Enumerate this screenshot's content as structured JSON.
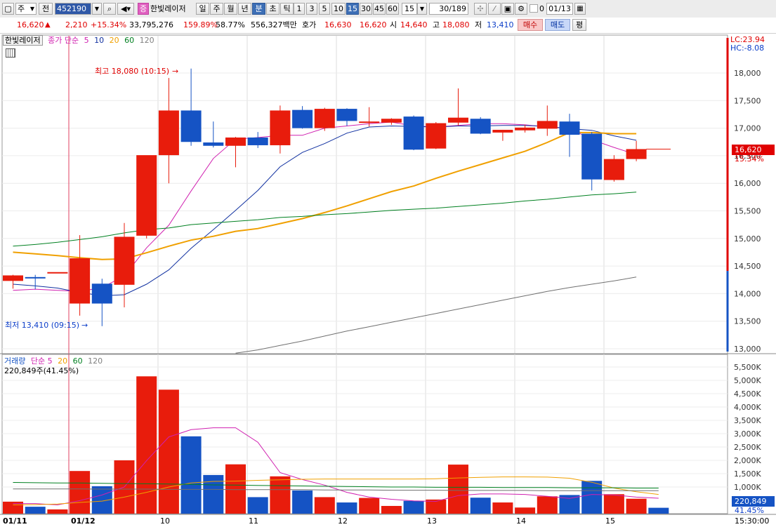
{
  "toolbar": {
    "market": "주",
    "prev_label": "전",
    "stock_code": "452190",
    "badge": "증",
    "stock_name": "한빛레이저",
    "period_tabs": [
      "일",
      "주",
      "월",
      "년",
      "분",
      "초",
      "틱"
    ],
    "active_period": "분",
    "interval_buttons": [
      "1",
      "3",
      "5",
      "10",
      "15",
      "30",
      "45",
      "60"
    ],
    "active_interval": "15",
    "interval_value": "15",
    "count_value": "30/189",
    "checkbox_label": "0",
    "date_value": "01/13"
  },
  "quote": {
    "price": "16,620",
    "direction": "▲",
    "change": "2,210",
    "change_pct": "+15.34%",
    "volume": "33,795,276",
    "ratio1": "159.89%",
    "ratio2": "58.77%",
    "amount": "556,327백만",
    "ask_label": "호가",
    "ask": "16,630",
    "bid": "16,620",
    "open_label": "시",
    "open": "14,640",
    "high_label": "고",
    "high": "18,080",
    "low_label": "저",
    "low": "13,410",
    "buy_label": "매수",
    "sell_label": "매도",
    "avg_label": "평"
  },
  "price_panel": {
    "tab_label": "한빛레이저",
    "legend_title": "종가 단순",
    "ma_periods": [
      "5",
      "10",
      "20",
      "60",
      "120"
    ],
    "ma_colors": [
      "#d020b0",
      "#1030a0",
      "#f0a000",
      "#008020",
      "#808080"
    ],
    "lc_label": "LC:23.94",
    "hc_label": "HC:-8.08",
    "current_price_tag": "16,620",
    "current_pct_tag": "15.34%",
    "high_annotation": "최고 18,080 (10:15)",
    "low_annotation": "최저 13,410 (09:15)"
  },
  "volume_panel": {
    "legend_title": "거래량",
    "legend_sub": "단순",
    "ma_periods": [
      "5",
      "20",
      "60",
      "120"
    ],
    "current_volume_label": "220,849주(41.45%)",
    "volume_tag": "220,849",
    "pct_tag": "41.45%"
  },
  "x_axis": {
    "labels": [
      "01/11",
      "01/12",
      "10",
      "11",
      "12",
      "13",
      "14",
      "15"
    ],
    "right_label": "15:30:00"
  },
  "chart_data": [
    {
      "type": "candlestick",
      "title": "한빛레이저",
      "unit": "원",
      "ylim": [
        13000,
        18400
      ],
      "yticks": [
        13000,
        13500,
        14000,
        14500,
        15000,
        15500,
        16000,
        16500,
        17000,
        17500,
        18000
      ],
      "candles": [
        {
          "o": 14230,
          "h": 14340,
          "l": 14090,
          "c": 14330
        },
        {
          "o": 14300,
          "h": 14340,
          "l": 14080,
          "c": 14280
        },
        {
          "o": 14390,
          "h": 14390,
          "l": 14390,
          "c": 14390
        },
        {
          "o": 13820,
          "h": 15060,
          "l": 13600,
          "c": 14640
        },
        {
          "o": 14180,
          "h": 14270,
          "l": 13410,
          "c": 13820
        },
        {
          "o": 14160,
          "h": 15280,
          "l": 13750,
          "c": 15030
        },
        {
          "o": 15050,
          "h": 16050,
          "l": 15000,
          "c": 16510
        },
        {
          "o": 16510,
          "h": 17910,
          "l": 16000,
          "c": 17320
        },
        {
          "o": 17320,
          "h": 18080,
          "l": 16680,
          "c": 16750
        },
        {
          "o": 16740,
          "h": 17120,
          "l": 16650,
          "c": 16680
        },
        {
          "o": 16680,
          "h": 16840,
          "l": 16290,
          "c": 16830
        },
        {
          "o": 16830,
          "h": 16930,
          "l": 16640,
          "c": 16690
        },
        {
          "o": 16690,
          "h": 17410,
          "l": 16540,
          "c": 17320
        },
        {
          "o": 17330,
          "h": 17400,
          "l": 16990,
          "c": 17000
        },
        {
          "o": 17000,
          "h": 17370,
          "l": 16950,
          "c": 17350
        },
        {
          "o": 17350,
          "h": 17360,
          "l": 17040,
          "c": 17130
        },
        {
          "o": 17100,
          "h": 17380,
          "l": 17030,
          "c": 17120
        },
        {
          "o": 17100,
          "h": 17180,
          "l": 17060,
          "c": 17170
        },
        {
          "o": 17210,
          "h": 17230,
          "l": 16600,
          "c": 16610
        },
        {
          "o": 16630,
          "h": 17110,
          "l": 16620,
          "c": 17090
        },
        {
          "o": 17100,
          "h": 17720,
          "l": 17050,
          "c": 17190
        },
        {
          "o": 17170,
          "h": 17200,
          "l": 16890,
          "c": 16900
        },
        {
          "o": 16920,
          "h": 16970,
          "l": 16770,
          "c": 16970
        },
        {
          "o": 16960,
          "h": 17060,
          "l": 16920,
          "c": 17010
        },
        {
          "o": 16990,
          "h": 17410,
          "l": 16860,
          "c": 17130
        },
        {
          "o": 17120,
          "h": 17260,
          "l": 16480,
          "c": 16880
        },
        {
          "o": 16900,
          "h": 16930,
          "l": 15870,
          "c": 16070
        },
        {
          "o": 16060,
          "h": 16510,
          "l": 16030,
          "c": 16440
        },
        {
          "o": 16440,
          "h": 16770,
          "l": 16400,
          "c": 16620
        }
      ],
      "ma": {
        "5": [
          14060,
          14080,
          14060,
          14040,
          14110,
          14320,
          14830,
          15240,
          15860,
          16450,
          16800,
          16830,
          16870,
          16870,
          17000,
          17040,
          17080,
          17110,
          17040,
          17020,
          17050,
          17080,
          17080,
          17060,
          17020,
          17000,
          16790,
          16650,
          16520
        ],
        "10": [
          14170,
          14140,
          14100,
          14020,
          13960,
          13980,
          14170,
          14430,
          14820,
          15160,
          15510,
          15870,
          16300,
          16560,
          16720,
          16910,
          17020,
          17040,
          17030,
          17020,
          17040,
          17040,
          17050,
          17050,
          17030,
          16990,
          16960,
          16860,
          16780
        ],
        "20": [
          14750,
          14720,
          14690,
          14650,
          14620,
          14630,
          14740,
          14860,
          14970,
          15040,
          15130,
          15180,
          15270,
          15360,
          15470,
          15590,
          15720,
          15850,
          15950,
          16090,
          16220,
          16340,
          16460,
          16580,
          16740,
          16920,
          16920,
          16900,
          16900
        ],
        "60": [
          14860,
          14890,
          14930,
          14980,
          15030,
          15100,
          15160,
          15190,
          15250,
          15280,
          15310,
          15340,
          15380,
          15400,
          15430,
          15450,
          15480,
          15510,
          15530,
          15550,
          15580,
          15610,
          15640,
          15680,
          15710,
          15750,
          15790,
          15810,
          15840
        ],
        "120": [
          null,
          null,
          null,
          null,
          null,
          null,
          null,
          null,
          null,
          null,
          12920,
          12980,
          13060,
          13140,
          13230,
          13320,
          13400,
          13480,
          13560,
          13640,
          13720,
          13800,
          13880,
          13960,
          14040,
          14110,
          14170,
          14230,
          14300
        ]
      }
    },
    {
      "type": "bar",
      "title": "거래량",
      "ylim": [
        0,
        5700000
      ],
      "yticks_labels": [
        "1,000K",
        "1,500K",
        "2,000K",
        "2,500K",
        "3,000K",
        "3,500K",
        "4,000K",
        "4,500K",
        "5,000K",
        "5,500K"
      ],
      "values": [
        450000,
        260000,
        160000,
        1600000,
        1030000,
        2000000,
        5150000,
        4650000,
        2900000,
        1450000,
        1850000,
        620000,
        1400000,
        870000,
        620000,
        420000,
        590000,
        290000,
        480000,
        530000,
        1840000,
        600000,
        420000,
        230000,
        650000,
        700000,
        1230000,
        730000,
        560000,
        220849
      ],
      "ma": {
        "5": [
          380000,
          380000,
          330000,
          490000,
          700000,
          1000000,
          1990000,
          2880000,
          3150000,
          3220000,
          3220000,
          2680000,
          1540000,
          1280000,
          1070000,
          800000,
          620000,
          540000,
          480000,
          460000,
          680000,
          740000,
          740000,
          720000,
          650000,
          570000,
          720000,
          700000,
          620000,
          580000
        ],
        "20": [
          330000,
          340000,
          360000,
          420000,
          470000,
          620000,
          800000,
          1000000,
          1150000,
          1210000,
          1220000,
          1250000,
          1270000,
          1290000,
          1300000,
          1300000,
          1300000,
          1300000,
          1300000,
          1310000,
          1340000,
          1360000,
          1380000,
          1380000,
          1370000,
          1330000,
          1180000,
          960000,
          820000,
          720000
        ],
        "60": [
          1170000,
          1160000,
          1150000,
          1150000,
          1140000,
          1130000,
          1120000,
          1110000,
          1100000,
          1080000,
          1070000,
          1060000,
          1050000,
          1040000,
          1030000,
          1020000,
          1010000,
          1000000,
          1000000,
          990000,
          990000,
          990000,
          980000,
          980000,
          980000,
          970000,
          970000,
          970000,
          960000,
          960000
        ],
        "120": [
          930000,
          930000,
          930000,
          930000,
          920000,
          920000,
          920000,
          910000,
          910000,
          910000,
          900000,
          900000,
          900000,
          900000,
          890000,
          890000,
          890000,
          880000,
          880000,
          880000,
          870000,
          870000,
          870000,
          870000,
          860000,
          860000,
          860000,
          860000,
          860000,
          860000
        ]
      }
    }
  ]
}
